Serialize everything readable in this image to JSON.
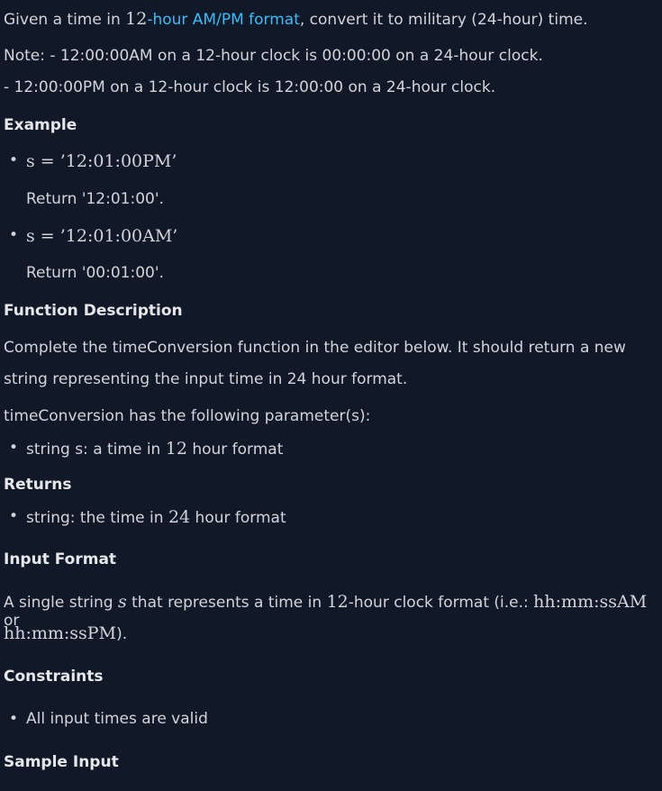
{
  "intro": {
    "prefix": "Given a time in ",
    "num": "12",
    "link": "-hour AM/PM format",
    "suffix": ", convert it to military (24-hour) time."
  },
  "note": {
    "line1": "Note: - 12:00:00AM on a 12-hour clock is 00:00:00 on a 24-hour clock.",
    "line2": "- 12:00:00PM on a 12-hour clock is 12:00:00 on a 24-hour clock."
  },
  "example": {
    "heading": "Example",
    "items": [
      {
        "math": "s = ’12:01:00PM’",
        "ret": "Return '12:01:00'."
      },
      {
        "math": "s = ’12:01:00AM’",
        "ret": "Return '00:01:00'."
      }
    ]
  },
  "function_description": {
    "heading": "Function Description",
    "line1": "Complete the timeConversion function in the editor below. It should return a new",
    "line2": "string representing the input time in 24 hour format.",
    "params_intro": "timeConversion has the following parameter(s):",
    "param_prefix": "string s: a time in ",
    "param_num": "12",
    "param_suffix": " hour format"
  },
  "returns": {
    "heading": "Returns",
    "prefix": "string: the time in ",
    "num": "24",
    "suffix": " hour format"
  },
  "input_format": {
    "heading": "Input Format",
    "l1_prefix": "A single string ",
    "l1_var": "s",
    "l1_mid": " that represents a time in ",
    "l1_num": "12",
    "l1_mid2": "-hour clock format (i.e.: ",
    "l1_math": "hh:mm:ssAM",
    "l1_suffix": " or",
    "l2_math": "hh:mm:ssPM",
    "l2_suffix": ")."
  },
  "constraints": {
    "heading": "Constraints",
    "item": "All input times are valid"
  },
  "sample_input": {
    "heading": "Sample Input"
  },
  "bullet_glyph": "•"
}
